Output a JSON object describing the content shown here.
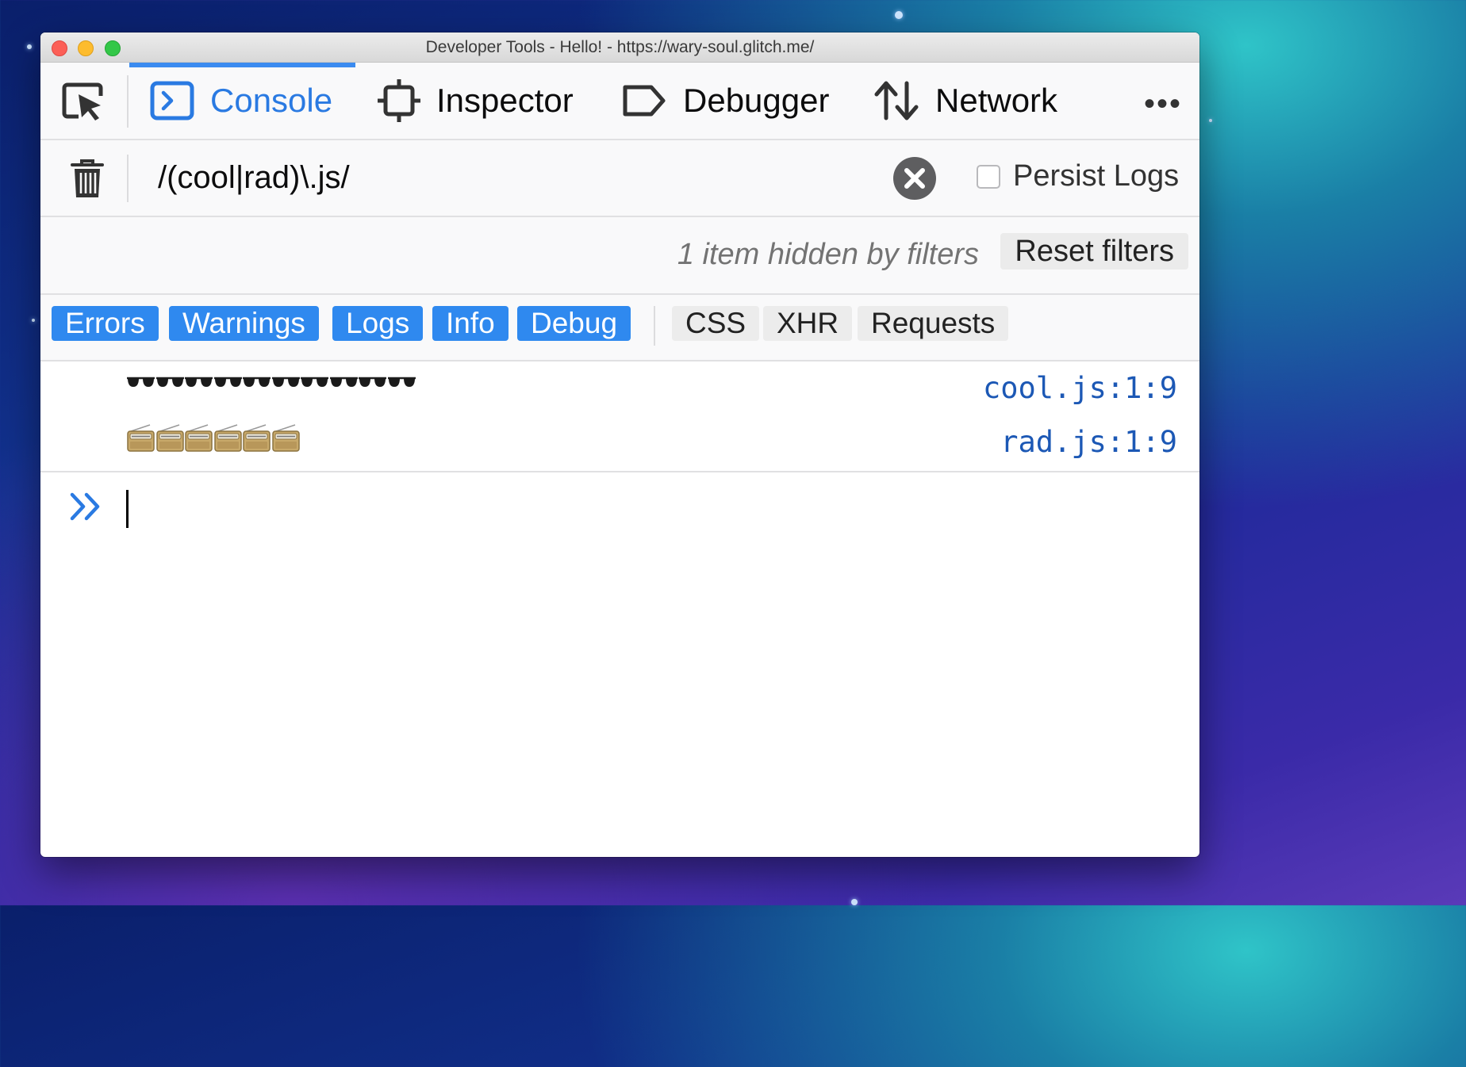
{
  "window": {
    "title": "Developer Tools - Hello! - https://wary-soul.glitch.me/"
  },
  "toolbar": {
    "tabs": [
      {
        "label": "Console",
        "icon": "console-icon",
        "active": true
      },
      {
        "label": "Inspector",
        "icon": "inspector-icon",
        "active": false
      },
      {
        "label": "Debugger",
        "icon": "debugger-icon",
        "active": false
      },
      {
        "label": "Network",
        "icon": "network-icon",
        "active": false
      }
    ],
    "more_label": "•••"
  },
  "filter": {
    "value": "/(cool|rad)\\.js/",
    "persist_label": "Persist Logs",
    "persist_checked": false
  },
  "hidden": {
    "message": "1 item hidden by filters",
    "reset_label": "Reset filters"
  },
  "levels": {
    "enabled": [
      "Errors",
      "Warnings",
      "Logs",
      "Info",
      "Debug"
    ],
    "disabled": [
      "CSS",
      "XHR",
      "Requests"
    ]
  },
  "messages": [
    {
      "content_icon": "sunglasses-icon",
      "repeat": 10,
      "location": "cool.js:1:9"
    },
    {
      "content_icon": "radio-icon",
      "repeat": 6,
      "location": "rad.js:1:9"
    }
  ],
  "colors": {
    "accent": "#2f89ef",
    "link": "#1c58b5"
  }
}
